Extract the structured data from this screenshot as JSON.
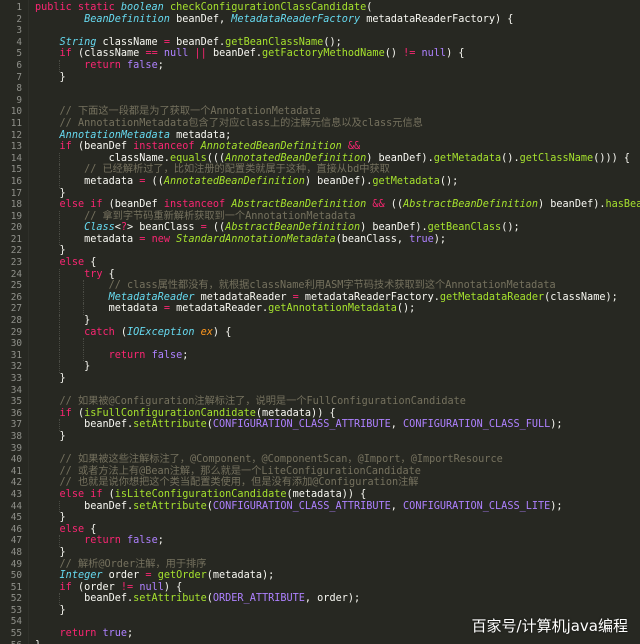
{
  "editor": {
    "theme_colors": {
      "background": "#272822",
      "text": "#f8f8f2",
      "keyword": "#f92672",
      "type": "#66d9ef",
      "function": "#a6e22e",
      "comment": "#75715e",
      "constant": "#ae81ff",
      "parameter": "#fd971f",
      "line_number": "#8f908a"
    },
    "lines": [
      {
        "n": "1",
        "indent": 0,
        "tokens": [
          [
            "kw",
            "public static "
          ],
          [
            "ty",
            "boolean"
          ],
          [
            "tx",
            " "
          ],
          [
            "fn",
            "checkConfigurationClassCandidate"
          ],
          [
            "tx",
            "("
          ]
        ]
      },
      {
        "n": "2",
        "indent": 0,
        "tokens": [
          [
            "tx",
            "        "
          ],
          [
            "ty",
            "BeanDefinition"
          ],
          [
            "tx",
            " beanDef, "
          ],
          [
            "ty",
            "MetadataReaderFactory"
          ],
          [
            "tx",
            " metadataReaderFactory) {"
          ]
        ]
      },
      {
        "n": "3",
        "indent": 1,
        "tokens": []
      },
      {
        "n": "4",
        "indent": 1,
        "tokens": [
          [
            "tx",
            "    "
          ],
          [
            "ty",
            "String"
          ],
          [
            "tx",
            " className "
          ],
          [
            "kw",
            "="
          ],
          [
            "tx",
            " beanDef."
          ],
          [
            "fn",
            "getBeanClassName"
          ],
          [
            "tx",
            "();"
          ]
        ]
      },
      {
        "n": "5",
        "indent": 1,
        "tokens": [
          [
            "tx",
            "    "
          ],
          [
            "kw",
            "if"
          ],
          [
            "tx",
            " (className "
          ],
          [
            "kw",
            "=="
          ],
          [
            "tx",
            " "
          ],
          [
            "nu",
            "null"
          ],
          [
            "tx",
            " "
          ],
          [
            "kw",
            "||"
          ],
          [
            "tx",
            " beanDef."
          ],
          [
            "fn",
            "getFactoryMethodName"
          ],
          [
            "tx",
            "() "
          ],
          [
            "kw",
            "!="
          ],
          [
            "tx",
            " "
          ],
          [
            "nu",
            "null"
          ],
          [
            "tx",
            ") {"
          ]
        ]
      },
      {
        "n": "6",
        "indent": 2,
        "tokens": [
          [
            "tx",
            "        "
          ],
          [
            "kw",
            "return"
          ],
          [
            "tx",
            " "
          ],
          [
            "nu",
            "false"
          ],
          [
            "tx",
            ";"
          ]
        ]
      },
      {
        "n": "7",
        "indent": 1,
        "tokens": [
          [
            "tx",
            "    }"
          ]
        ]
      },
      {
        "n": "8",
        "indent": 1,
        "tokens": []
      },
      {
        "n": "9",
        "indent": 1,
        "tokens": []
      },
      {
        "n": "10",
        "indent": 1,
        "tokens": [
          [
            "tx",
            "    "
          ],
          [
            "cm",
            "// 下面这一段都是为了获取一个AnnotationMetadata"
          ]
        ]
      },
      {
        "n": "11",
        "indent": 1,
        "tokens": [
          [
            "tx",
            "    "
          ],
          [
            "cm",
            "// AnnotationMetadata包含了对应class上的注解元信息以及class元信息"
          ]
        ]
      },
      {
        "n": "12",
        "indent": 1,
        "tokens": [
          [
            "tx",
            "    "
          ],
          [
            "ty",
            "AnnotationMetadata"
          ],
          [
            "tx",
            " metadata;"
          ]
        ]
      },
      {
        "n": "13",
        "indent": 1,
        "tokens": [
          [
            "tx",
            "    "
          ],
          [
            "kw",
            "if"
          ],
          [
            "tx",
            " (beanDef "
          ],
          [
            "kw",
            "instanceof"
          ],
          [
            "tx",
            " "
          ],
          [
            "it",
            "AnnotatedBeanDefinition"
          ],
          [
            "tx",
            " "
          ],
          [
            "kw",
            "&&"
          ]
        ]
      },
      {
        "n": "14",
        "indent": 2,
        "tokens": [
          [
            "tx",
            "            className."
          ],
          [
            "fn",
            "equals"
          ],
          [
            "tx",
            "((("
          ],
          [
            "it",
            "AnnotatedBeanDefinition"
          ],
          [
            "tx",
            ") beanDef)."
          ],
          [
            "fn",
            "getMetadata"
          ],
          [
            "tx",
            "()."
          ],
          [
            "fn",
            "getClassName"
          ],
          [
            "tx",
            "())) {"
          ]
        ]
      },
      {
        "n": "15",
        "indent": 2,
        "tokens": [
          [
            "tx",
            "        "
          ],
          [
            "cm",
            "// 已经解析过了，比如注册的配置类就属于这种，直接从bd中获取"
          ]
        ]
      },
      {
        "n": "16",
        "indent": 2,
        "tokens": [
          [
            "tx",
            "        metadata "
          ],
          [
            "kw",
            "="
          ],
          [
            "tx",
            " (("
          ],
          [
            "it",
            "AnnotatedBeanDefinition"
          ],
          [
            "tx",
            ") beanDef)."
          ],
          [
            "fn",
            "getMetadata"
          ],
          [
            "tx",
            "();"
          ]
        ]
      },
      {
        "n": "17",
        "indent": 1,
        "tokens": [
          [
            "tx",
            "    }"
          ]
        ]
      },
      {
        "n": "18",
        "indent": 1,
        "tokens": [
          [
            "tx",
            "    "
          ],
          [
            "kw",
            "else if"
          ],
          [
            "tx",
            " (beanDef "
          ],
          [
            "kw",
            "instanceof"
          ],
          [
            "tx",
            " "
          ],
          [
            "it",
            "AbstractBeanDefinition"
          ],
          [
            "tx",
            " "
          ],
          [
            "kw",
            "&&"
          ],
          [
            "tx",
            " (("
          ],
          [
            "it",
            "AbstractBeanDefinition"
          ],
          [
            "tx",
            ") beanDef)."
          ],
          [
            "fn",
            "hasBeanClass"
          ],
          [
            "tx",
            "()) {"
          ]
        ]
      },
      {
        "n": "19",
        "indent": 2,
        "tokens": [
          [
            "tx",
            "        "
          ],
          [
            "cm",
            "// 拿到字节码重新解析获取到一个AnnotationMetadata"
          ]
        ]
      },
      {
        "n": "20",
        "indent": 2,
        "tokens": [
          [
            "tx",
            "        "
          ],
          [
            "ty",
            "Class"
          ],
          [
            "tx",
            "<"
          ],
          [
            "kw",
            "?"
          ],
          [
            "tx",
            "> beanClass "
          ],
          [
            "kw",
            "="
          ],
          [
            "tx",
            " (("
          ],
          [
            "it",
            "AbstractBeanDefinition"
          ],
          [
            "tx",
            ") beanDef)."
          ],
          [
            "fn",
            "getBeanClass"
          ],
          [
            "tx",
            "();"
          ]
        ]
      },
      {
        "n": "21",
        "indent": 2,
        "tokens": [
          [
            "tx",
            "        metadata "
          ],
          [
            "kw",
            "="
          ],
          [
            "tx",
            " "
          ],
          [
            "kw",
            "new"
          ],
          [
            "tx",
            " "
          ],
          [
            "it",
            "StandardAnnotationMetadata"
          ],
          [
            "tx",
            "(beanClass, "
          ],
          [
            "nu",
            "true"
          ],
          [
            "tx",
            ");"
          ]
        ]
      },
      {
        "n": "22",
        "indent": 1,
        "tokens": [
          [
            "tx",
            "    }"
          ]
        ]
      },
      {
        "n": "23",
        "indent": 1,
        "tokens": [
          [
            "tx",
            "    "
          ],
          [
            "kw",
            "else"
          ],
          [
            "tx",
            " {"
          ]
        ]
      },
      {
        "n": "24",
        "indent": 2,
        "tokens": [
          [
            "tx",
            "        "
          ],
          [
            "kw",
            "try"
          ],
          [
            "tx",
            " {"
          ]
        ]
      },
      {
        "n": "25",
        "indent": 3,
        "tokens": [
          [
            "tx",
            "            "
          ],
          [
            "cm",
            "// class属性都没有，就根据className利用ASM字节码技术获取到这个AnnotationMetadata"
          ]
        ]
      },
      {
        "n": "26",
        "indent": 3,
        "tokens": [
          [
            "tx",
            "            "
          ],
          [
            "ty",
            "MetadataReader"
          ],
          [
            "tx",
            " metadataReader "
          ],
          [
            "kw",
            "="
          ],
          [
            "tx",
            " metadataReaderFactory."
          ],
          [
            "fn",
            "getMetadataReader"
          ],
          [
            "tx",
            "(className);"
          ]
        ]
      },
      {
        "n": "27",
        "indent": 3,
        "tokens": [
          [
            "tx",
            "            metadata "
          ],
          [
            "kw",
            "="
          ],
          [
            "tx",
            " metadataReader."
          ],
          [
            "fn",
            "getAnnotationMetadata"
          ],
          [
            "tx",
            "();"
          ]
        ]
      },
      {
        "n": "28",
        "indent": 2,
        "tokens": [
          [
            "tx",
            "        }"
          ]
        ]
      },
      {
        "n": "29",
        "indent": 2,
        "tokens": [
          [
            "tx",
            "        "
          ],
          [
            "kw",
            "catch"
          ],
          [
            "tx",
            " ("
          ],
          [
            "ty",
            "IOException"
          ],
          [
            "tx",
            " "
          ],
          [
            "pa",
            "ex"
          ],
          [
            "tx",
            ") {"
          ]
        ]
      },
      {
        "n": "30",
        "indent": 3,
        "tokens": []
      },
      {
        "n": "31",
        "indent": 3,
        "tokens": [
          [
            "tx",
            "            "
          ],
          [
            "kw",
            "return"
          ],
          [
            "tx",
            " "
          ],
          [
            "nu",
            "false"
          ],
          [
            "tx",
            ";"
          ]
        ]
      },
      {
        "n": "32",
        "indent": 2,
        "tokens": [
          [
            "tx",
            "        }"
          ]
        ]
      },
      {
        "n": "33",
        "indent": 1,
        "tokens": [
          [
            "tx",
            "    }"
          ]
        ]
      },
      {
        "n": "34",
        "indent": 1,
        "tokens": []
      },
      {
        "n": "35",
        "indent": 1,
        "tokens": [
          [
            "tx",
            "    "
          ],
          [
            "cm",
            "// 如果被@Configuration注解标注了，说明是一个FullConfigurationCandidate"
          ]
        ]
      },
      {
        "n": "36",
        "indent": 1,
        "tokens": [
          [
            "tx",
            "    "
          ],
          [
            "kw",
            "if"
          ],
          [
            "tx",
            " ("
          ],
          [
            "fn",
            "isFullConfigurationCandidate"
          ],
          [
            "tx",
            "(metadata)) {"
          ]
        ]
      },
      {
        "n": "37",
        "indent": 2,
        "tokens": [
          [
            "tx",
            "        beanDef."
          ],
          [
            "fn",
            "setAttribute"
          ],
          [
            "tx",
            "("
          ],
          [
            "nu",
            "CONFIGURATION_CLASS_ATTRIBUTE"
          ],
          [
            "tx",
            ", "
          ],
          [
            "nu",
            "CONFIGURATION_CLASS_FULL"
          ],
          [
            "tx",
            ");"
          ]
        ]
      },
      {
        "n": "38",
        "indent": 1,
        "tokens": [
          [
            "tx",
            "    }"
          ]
        ]
      },
      {
        "n": "39",
        "indent": 1,
        "tokens": []
      },
      {
        "n": "40",
        "indent": 1,
        "tokens": [
          [
            "tx",
            "    "
          ],
          [
            "cm",
            "// 如果被这些注解标注了，@Component，@ComponentScan，@Import，@ImportResource"
          ]
        ]
      },
      {
        "n": "41",
        "indent": 1,
        "tokens": [
          [
            "tx",
            "    "
          ],
          [
            "cm",
            "// 或者方法上有@Bean注解，那么就是一个LiteConfigurationCandidate"
          ]
        ]
      },
      {
        "n": "42",
        "indent": 1,
        "tokens": [
          [
            "tx",
            "    "
          ],
          [
            "cm",
            "// 也就是说你想把这个类当配置类使用，但是没有添加@Configuration注解"
          ]
        ]
      },
      {
        "n": "43",
        "indent": 1,
        "tokens": [
          [
            "tx",
            "    "
          ],
          [
            "kw",
            "else if"
          ],
          [
            "tx",
            " ("
          ],
          [
            "fn",
            "isLiteConfigurationCandidate"
          ],
          [
            "tx",
            "(metadata)) {"
          ]
        ]
      },
      {
        "n": "44",
        "indent": 2,
        "tokens": [
          [
            "tx",
            "        beanDef."
          ],
          [
            "fn",
            "setAttribute"
          ],
          [
            "tx",
            "("
          ],
          [
            "nu",
            "CONFIGURATION_CLASS_ATTRIBUTE"
          ],
          [
            "tx",
            ", "
          ],
          [
            "nu",
            "CONFIGURATION_CLASS_LITE"
          ],
          [
            "tx",
            ");"
          ]
        ]
      },
      {
        "n": "45",
        "indent": 1,
        "tokens": [
          [
            "tx",
            "    }"
          ]
        ]
      },
      {
        "n": "46",
        "indent": 1,
        "tokens": [
          [
            "tx",
            "    "
          ],
          [
            "kw",
            "else"
          ],
          [
            "tx",
            " {"
          ]
        ]
      },
      {
        "n": "47",
        "indent": 2,
        "tokens": [
          [
            "tx",
            "        "
          ],
          [
            "kw",
            "return"
          ],
          [
            "tx",
            " "
          ],
          [
            "nu",
            "false"
          ],
          [
            "tx",
            ";"
          ]
        ]
      },
      {
        "n": "48",
        "indent": 1,
        "tokens": [
          [
            "tx",
            "    }"
          ]
        ]
      },
      {
        "n": "49",
        "indent": 1,
        "tokens": [
          [
            "tx",
            "    "
          ],
          [
            "cm",
            "// 解析@Order注解，用于排序"
          ]
        ]
      },
      {
        "n": "50",
        "indent": 1,
        "tokens": [
          [
            "tx",
            "    "
          ],
          [
            "ty",
            "Integer"
          ],
          [
            "tx",
            " order "
          ],
          [
            "kw",
            "="
          ],
          [
            "tx",
            " "
          ],
          [
            "fn",
            "getOrder"
          ],
          [
            "tx",
            "(metadata);"
          ]
        ]
      },
      {
        "n": "51",
        "indent": 1,
        "tokens": [
          [
            "tx",
            "    "
          ],
          [
            "kw",
            "if"
          ],
          [
            "tx",
            " (order "
          ],
          [
            "kw",
            "!="
          ],
          [
            "tx",
            " "
          ],
          [
            "nu",
            "null"
          ],
          [
            "tx",
            ") {"
          ]
        ]
      },
      {
        "n": "52",
        "indent": 2,
        "tokens": [
          [
            "tx",
            "        beanDef."
          ],
          [
            "fn",
            "setAttribute"
          ],
          [
            "tx",
            "("
          ],
          [
            "nu",
            "ORDER_ATTRIBUTE"
          ],
          [
            "tx",
            ", order);"
          ]
        ]
      },
      {
        "n": "53",
        "indent": 1,
        "tokens": [
          [
            "tx",
            "    }"
          ]
        ]
      },
      {
        "n": "54",
        "indent": 1,
        "tokens": []
      },
      {
        "n": "55",
        "indent": 1,
        "tokens": [
          [
            "tx",
            "    "
          ],
          [
            "kw",
            "return"
          ],
          [
            "tx",
            " "
          ],
          [
            "nu",
            "true"
          ],
          [
            "tx",
            ";"
          ]
        ]
      },
      {
        "n": "56",
        "indent": 0,
        "tokens": [
          [
            "tx",
            "}"
          ]
        ]
      }
    ]
  },
  "watermark": {
    "text": "百家号/计算机java编程"
  }
}
